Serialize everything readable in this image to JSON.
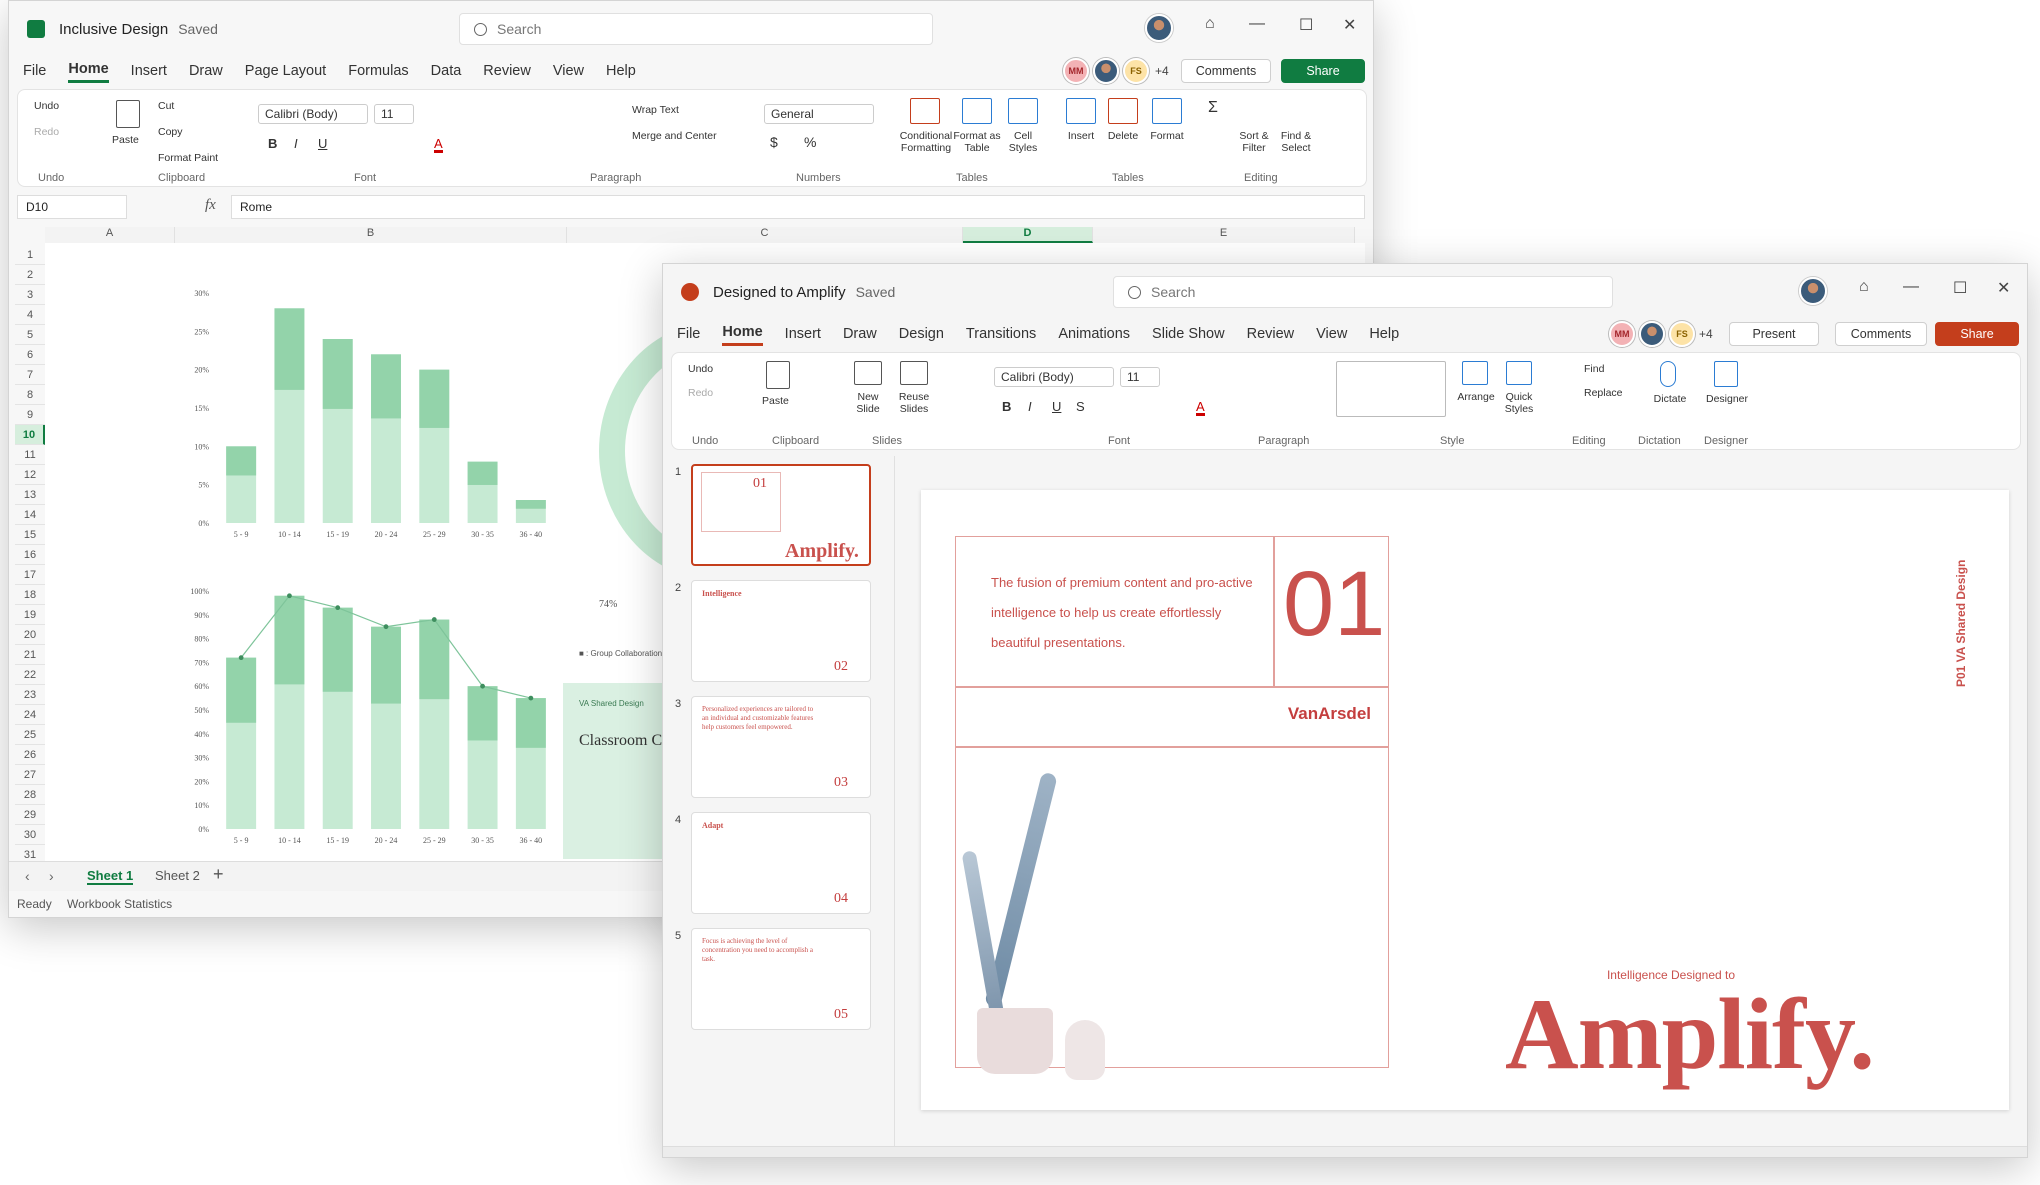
{
  "excel": {
    "title": "Inclusive Design",
    "saved": "Saved",
    "search_placeholder": "Search",
    "menus": [
      "File",
      "Home",
      "Insert",
      "Draw",
      "Page Layout",
      "Formulas",
      "Data",
      "Review",
      "View",
      "Help"
    ],
    "collab": {
      "chip1": "MM",
      "chip3": "FS",
      "more": "+4",
      "comments": "Comments",
      "share": "Share"
    },
    "ribbon": {
      "undo": "Undo",
      "redo": "Redo",
      "paste": "Paste",
      "cut": "Cut",
      "copy": "Copy",
      "format_paint": "Format Paint",
      "font_name": "Calibri (Body)",
      "font_size": "11",
      "wrap_text": "Wrap Text",
      "merge_center": "Merge and Center",
      "number_format": "General",
      "conditional": "Conditional Formatting",
      "format_table": "Format as Table",
      "cell_styles": "Cell Styles",
      "insert": "Insert",
      "delete": "Delete",
      "format": "Format",
      "sort_filter": "Sort & Filter",
      "find_select": "Find & Select",
      "groups": [
        "Undo",
        "Clipboard",
        "Font",
        "Paragraph",
        "Numbers",
        "Tables",
        "Tables",
        "Editing"
      ]
    },
    "formula_bar": {
      "name_box": "D10",
      "fx": "fx",
      "value": "Rome"
    },
    "columns": [
      "A",
      "B",
      "C",
      "D",
      "E"
    ],
    "active_column": "D",
    "active_row": "10",
    "rows": [
      "1",
      "2",
      "3",
      "4",
      "5",
      "6",
      "7",
      "8",
      "9",
      "10",
      "11",
      "12",
      "13",
      "14",
      "15",
      "16",
      "17",
      "18",
      "19",
      "20",
      "21",
      "22",
      "23",
      "24",
      "25",
      "26",
      "27",
      "28",
      "29",
      "30",
      "31"
    ],
    "sheets": [
      "Sheet 1",
      "Sheet 2"
    ],
    "status": {
      "ready": "Ready",
      "stats": "Workbook Statistics"
    },
    "donut_label": "74%",
    "legend": "Group Collaboration",
    "card": {
      "kicker": "VA Shared Design",
      "title": "Classroom C"
    }
  },
  "chart_data": [
    {
      "type": "bar",
      "categories": [
        "5 - 9",
        "10 - 14",
        "15 - 19",
        "20 - 24",
        "25 - 29",
        "30 - 35",
        "36 - 40"
      ],
      "values": [
        10,
        28,
        24,
        22,
        20,
        8,
        3
      ],
      "ylim": [
        0,
        30
      ],
      "yticks": [
        "0%",
        "5%",
        "10%",
        "15%",
        "20%",
        "25%",
        "30%"
      ]
    },
    {
      "type": "bar",
      "categories": [
        "5 - 9",
        "10 - 14",
        "15 - 19",
        "20 - 24",
        "25 - 29",
        "30 - 35",
        "36 - 40"
      ],
      "values": [
        72,
        98,
        93,
        85,
        88,
        60,
        55
      ],
      "line": [
        72,
        98,
        93,
        85,
        88,
        60,
        55
      ],
      "ylim": [
        0,
        100
      ],
      "yticks": [
        "0%",
        "10%",
        "20%",
        "30%",
        "40%",
        "50%",
        "60%",
        "70%",
        "80%",
        "90%",
        "100%"
      ]
    }
  ],
  "ppt": {
    "title": "Designed to Amplify",
    "saved": "Saved",
    "search_placeholder": "Search",
    "menus": [
      "File",
      "Home",
      "Insert",
      "Draw",
      "Design",
      "Transitions",
      "Animations",
      "Slide Show",
      "Review",
      "View",
      "Help"
    ],
    "collab": {
      "chip1": "MM",
      "chip3": "FS",
      "more": "+4",
      "present": "Present",
      "comments": "Comments",
      "share": "Share"
    },
    "ribbon": {
      "undo": "Undo",
      "redo": "Redo",
      "paste": "Paste",
      "new_slide": "New Slide",
      "reuse": "Reuse Slides",
      "font_name": "Calibri (Body)",
      "font_size": "11",
      "arrange": "Arrange",
      "quick_styles": "Quick Styles",
      "find": "Find",
      "replace": "Replace",
      "dictate": "Dictate",
      "designer": "Designer",
      "groups": [
        "Undo",
        "Clipboard",
        "Slides",
        "Font",
        "Paragraph",
        "Style",
        "Editing",
        "Dictation",
        "Designer"
      ]
    },
    "thumbs": [
      {
        "n": "1",
        "num": "01",
        "word": "Amplify."
      },
      {
        "n": "2",
        "num": "02",
        "head": "Intelligence"
      },
      {
        "n": "3",
        "num": "03",
        "head": "Personalized experiences are tailored to an individual and customizable features help customers feel empowered."
      },
      {
        "n": "4",
        "num": "04",
        "head": "Adapt"
      },
      {
        "n": "5",
        "num": "05",
        "head": "Focus is achieving the level of concentration you need to accomplish a task."
      }
    ],
    "slide": {
      "body": "The fusion of premium content and pro-active intelligence to help us create effortlessly beautiful presentations.",
      "num": "01",
      "brand": "VanArsdel",
      "side": "P01  VA Shared Design",
      "kicker": "Intelligence Designed to",
      "big": "Amplify."
    }
  }
}
